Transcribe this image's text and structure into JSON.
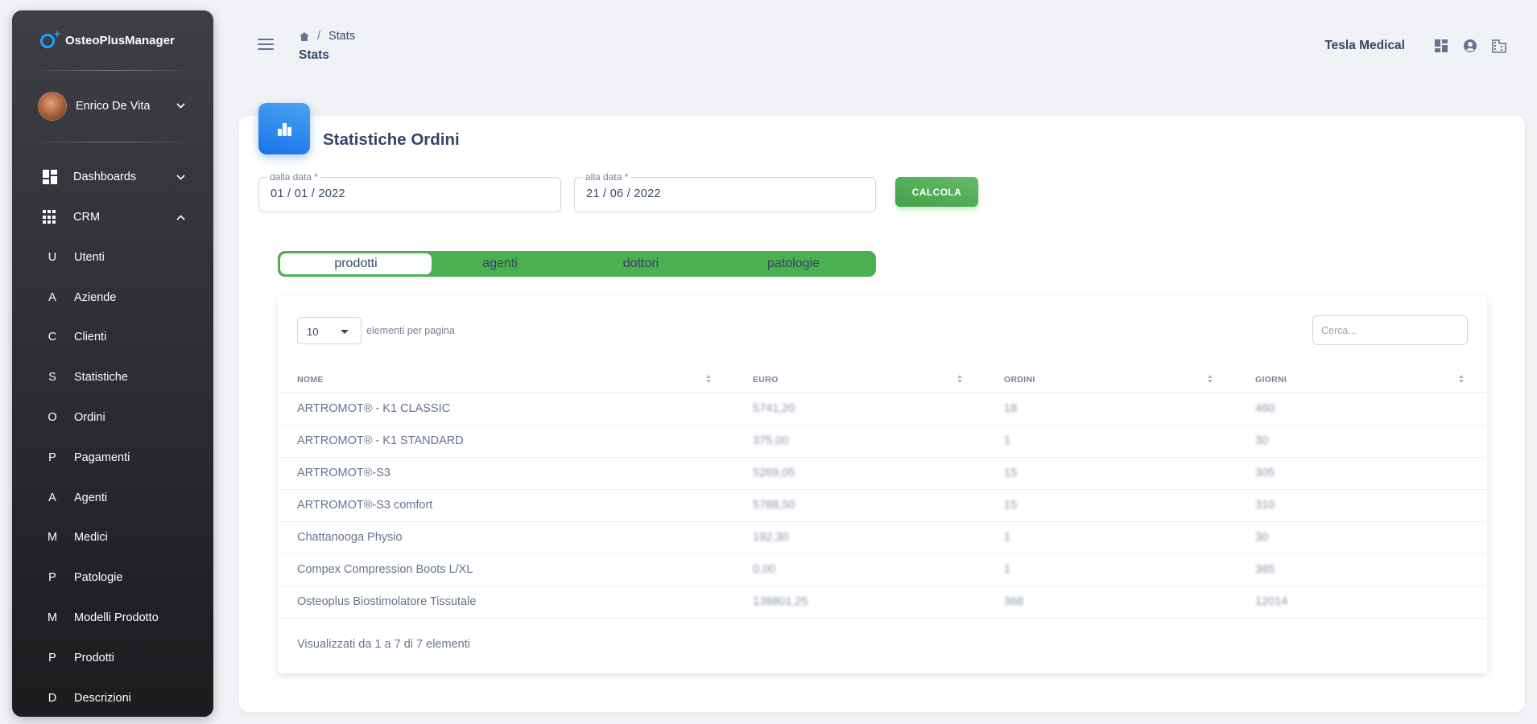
{
  "sidebar": {
    "brand": "OsteoPlusManager",
    "user": "Enrico De Vita",
    "groups": [
      {
        "label": "Dashboards",
        "icon": "dashboard-icon",
        "expanded": false
      },
      {
        "label": "CRM",
        "icon": "apps-grid-icon",
        "expanded": true
      }
    ],
    "items": [
      {
        "letter": "U",
        "label": "Utenti"
      },
      {
        "letter": "A",
        "label": "Aziende"
      },
      {
        "letter": "C",
        "label": "Clienti"
      },
      {
        "letter": "S",
        "label": "Statistiche"
      },
      {
        "letter": "O",
        "label": "Ordini"
      },
      {
        "letter": "P",
        "label": "Pagamenti"
      },
      {
        "letter": "A",
        "label": "Agenti"
      },
      {
        "letter": "M",
        "label": "Medici"
      },
      {
        "letter": "P",
        "label": "Patologie"
      },
      {
        "letter": "M",
        "label": "Modelli Prodotto"
      },
      {
        "letter": "P",
        "label": "Prodotti"
      },
      {
        "letter": "D",
        "label": "Descrizioni"
      }
    ]
  },
  "header": {
    "breadcrumb": "Stats",
    "separator": "/",
    "title": "Stats",
    "company": "Tesla Medical"
  },
  "main": {
    "title": "Statistiche Ordini",
    "from_label": "dalla data *",
    "from_value": "01 / 01 / 2022",
    "to_label": "alla data *",
    "to_value": "21 / 06 / 2022",
    "calc_label": "CALCOLA",
    "tabs": [
      "prodotti",
      "agenti",
      "dottori",
      "patologie"
    ],
    "active_tab": "prodotti"
  },
  "table": {
    "per_page": "10",
    "per_page_label": "elementi per pagina",
    "search_placeholder": "Cerca...",
    "columns": [
      "NOME",
      "EURO",
      "ORDINI",
      "GIORNI"
    ],
    "rows": [
      [
        "ARTROMOT® - K1 CLASSIC",
        "5741,20",
        "18",
        "460"
      ],
      [
        "ARTROMOT® - K1 STANDARD",
        "375,00",
        "1",
        "30"
      ],
      [
        "ARTROMOT®-S3",
        "5269,05",
        "15",
        "305"
      ],
      [
        "ARTROMOT®-S3 comfort",
        "5788,50",
        "15",
        "310"
      ],
      [
        "Chattanooga Physio",
        "192,30",
        "1",
        "30"
      ],
      [
        "Compex Compression Boots L/XL",
        "0,00",
        "1",
        "365"
      ],
      [
        "Osteoplus Biostimolatore Tissutale",
        "138801,25",
        "368",
        "12014"
      ]
    ],
    "footer": "Visualizzati da 1 a 7 di 7 elementi"
  },
  "colors": {
    "accent_blue": "#1a73e8",
    "accent_green": "#4caf50",
    "text": "#344767"
  }
}
